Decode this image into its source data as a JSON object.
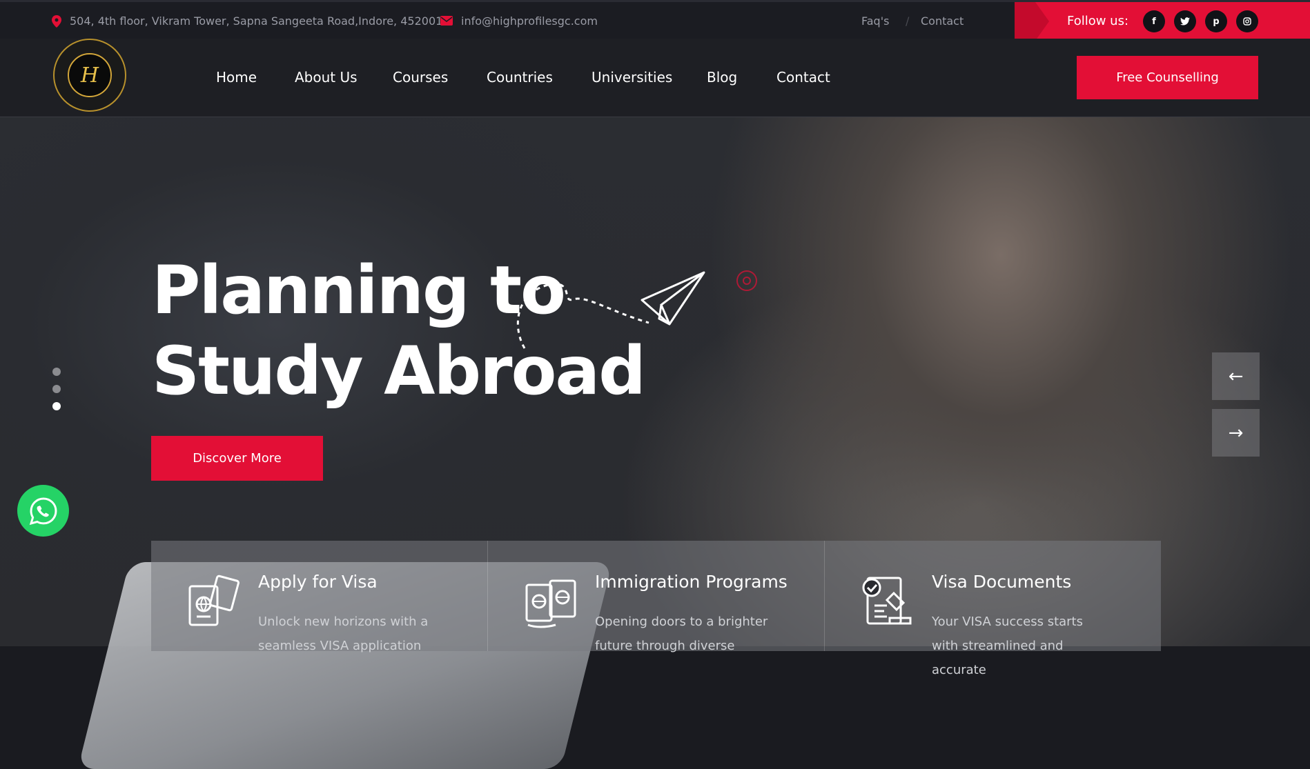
{
  "topbar": {
    "address": "504, 4th floor, Vikram Tower, Sapna Sangeeta Road,Indore, 452001",
    "email": "info@highprofilesgc.com",
    "faq": "Faq's",
    "contact": "Contact",
    "follow_label": "Follow us:",
    "social": [
      "f",
      "t",
      "p",
      "i"
    ]
  },
  "nav": {
    "items": [
      "Home",
      "About Us",
      "Courses",
      "Countries",
      "Universities",
      "Blog",
      "Contact"
    ],
    "cta": "Free Counselling"
  },
  "hero": {
    "line1": "Planning to",
    "line2": "Study Abroad",
    "button": "Discover More",
    "prev_arrow": "←",
    "next_arrow": "→"
  },
  "features": [
    {
      "title": "Apply for Visa",
      "desc": "Unlock new horizons with a seamless VISA application"
    },
    {
      "title": "Immigration Programs",
      "desc": "Opening doors to a brighter future through diverse"
    },
    {
      "title": "Visa Documents",
      "desc": "Your VISA success starts with streamlined and accurate"
    }
  ],
  "colors": {
    "accent": "#e30f36",
    "topbar": "#1b1c22",
    "whatsapp": "#25d366"
  }
}
